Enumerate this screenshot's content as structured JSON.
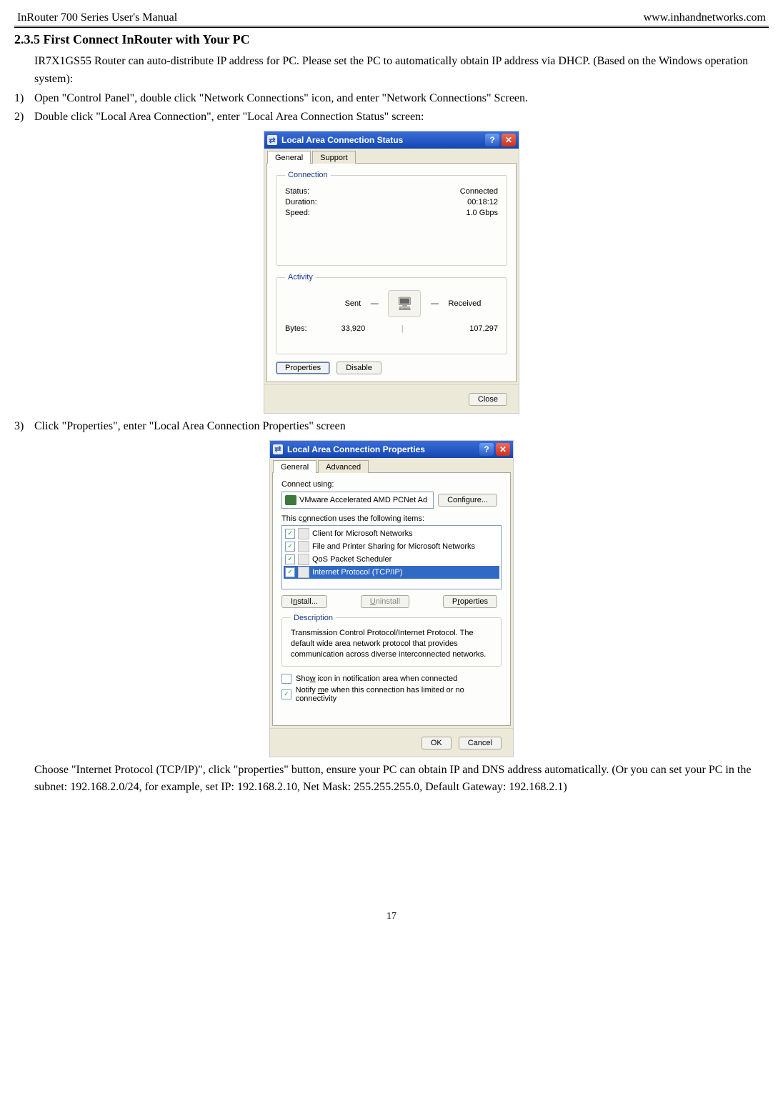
{
  "header": {
    "left": "InRouter 700 Series User's Manual",
    "right": "www.inhandnetworks.com"
  },
  "section_title": "2.3.5 First Connect InRouter with Your PC",
  "intro": "IR7X1GS55 Router can auto-distribute IP address for PC. Please set the PC to automatically obtain IP address via DHCP. (Based on the Windows operation system):",
  "steps": {
    "s1": "Open \"Control Panel\", double click \"Network Connections\" icon, and enter \"Network Connections\" Screen.",
    "s2": "Double click \"Local Area Connection\", enter \"Local Area Connection Status\" screen:",
    "s3": "Click \"Properties\", enter \"Local Area Connection Properties\" screen"
  },
  "status_dlg": {
    "title": "Local Area Connection Status",
    "tabs": {
      "general": "General",
      "support": "Support"
    },
    "connection": {
      "legend": "Connection",
      "status_k": "Status:",
      "status_v": "Connected",
      "duration_k": "Duration:",
      "duration_v": "00:18:12",
      "speed_k": "Speed:",
      "speed_v": "1.0 Gbps"
    },
    "activity": {
      "legend": "Activity",
      "sent": "Sent",
      "received": "Received",
      "bytes_k": "Bytes:",
      "bytes_sent": "33,920",
      "bytes_recv": "107,297"
    },
    "buttons": {
      "properties": "Properties",
      "disable": "Disable",
      "close": "Close"
    }
  },
  "props_dlg": {
    "title": "Local Area Connection Properties",
    "tabs": {
      "general": "General",
      "advanced": "Advanced"
    },
    "connect_using": "Connect using:",
    "adapter": "VMware Accelerated AMD PCNet Ad",
    "configure": "Configure...",
    "uses_label": "This connection uses the following items:",
    "items": {
      "i1": "Client for Microsoft Networks",
      "i2": "File and Printer Sharing for Microsoft Networks",
      "i3": "QoS Packet Scheduler",
      "i4": "Internet Protocol (TCP/IP)"
    },
    "install": "Install...",
    "uninstall": "Uninstall",
    "properties": "Properties",
    "desc_legend": "Description",
    "desc_text": "Transmission Control Protocol/Internet Protocol. The default wide area network protocol that provides communication across diverse interconnected networks.",
    "chk_show": "Show icon in notification area when connected",
    "chk_notify": "Notify me when this connection has limited or no connectivity",
    "ok": "OK",
    "cancel": "Cancel"
  },
  "tail_text": "Choose \"Internet Protocol (TCP/IP)\", click \"properties\" button, ensure your PC can obtain IP and DNS address automatically. (Or you can set your PC in the subnet: 192.168.2.0/24, for example, set IP: 192.168.2.10, Net Mask: 255.255.255.0, Default Gateway: 192.168.2.1)",
  "page_number": "17"
}
